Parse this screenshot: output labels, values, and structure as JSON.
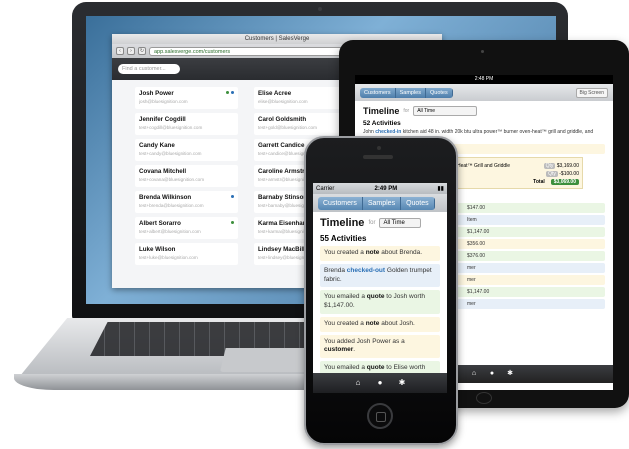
{
  "browser": {
    "window_title": "Customers | SalesVerge",
    "url": "app.salesverge.com/customers",
    "search_placeholder": "Find a customer..."
  },
  "customers": [
    {
      "name": "Josh Power",
      "email": "josh@bluesignition.com"
    },
    {
      "name": "Elise Acree",
      "email": "elise@bluesignition.com"
    },
    {
      "name": "Jennifer Cogdill",
      "email": "test+cogdill@bluesignition.com"
    },
    {
      "name": "Carol Goldsmith",
      "email": "test+gold@bluesignition.com"
    },
    {
      "name": "Candy Kane",
      "email": "test+candy@bluesignition.com"
    },
    {
      "name": "Garrett Candice",
      "email": "test+candice@bluesignition.com"
    },
    {
      "name": "Covana Mitchell",
      "email": "test+covana@bluesignition.com"
    },
    {
      "name": "Caroline Armstr",
      "email": "test+armstr@bluesignition.com"
    },
    {
      "name": "Brenda Wilkinson",
      "email": "test+brenda@bluesignition.com"
    },
    {
      "name": "Barnaby Stinson",
      "email": "test+barnaby@bluesignition.com"
    },
    {
      "name": "Albert Sorarro",
      "email": "test+albert@bluesignition.com"
    },
    {
      "name": "Karma Eisenhar",
      "email": "test+karma@bluesignition.com"
    },
    {
      "name": "Luke Wilson",
      "email": "test+luke@bluesignition.com"
    },
    {
      "name": "Lindsey MacBill",
      "email": "test+lindsey@bluesignition.com"
    }
  ],
  "ipad": {
    "status_time": "2:48 PM",
    "tabs": [
      "Customers",
      "Samples",
      "Quotes"
    ],
    "big_screen": "Big Screen",
    "timeline_title": "Timeline",
    "for_label": "for",
    "filter_value": "All Time",
    "activity_count": "52 Activities",
    "first_activity_pre": "John",
    "first_activity_action": "checked-in",
    "first_activity_post": "kitchen aid 48 in. width 20k btu ultra power™ burner oven-heat™ grill and griddle, and Orange tango shade fabric",
    "amount_row": "$3,093.00",
    "order_item": "Burner Oven-Heat™ Grill and Griddle",
    "order_qty": "Qty",
    "order_price_1": "$3,169.00",
    "order_price_2": "-$100.00",
    "total_label": "Total",
    "total_value": "$3,069.00",
    "side_amounts": [
      "$147.00",
      "$1,147.00",
      "$356.00",
      "$376.00",
      "$1,147.00"
    ],
    "side_words": [
      "Item",
      "mer",
      "mer",
      "mer"
    ]
  },
  "iphone": {
    "carrier": "Carrier",
    "time": "2:49 PM",
    "tabs": [
      "Customers",
      "Samples",
      "Quotes"
    ],
    "timeline_title": "Timeline",
    "for_label": "for",
    "filter_value": "All Time",
    "activity_count": "55 Activities",
    "items": {
      "a1_pre": "You created a",
      "a1_bold": "note",
      "a1_post": "about Brenda.",
      "a2_pre": "Brenda",
      "a2_action": "checked-out",
      "a2_post": "Golden trumpet fabric.",
      "a3_pre": "You emailed a",
      "a3_bold": "quote",
      "a3_post": "to Josh worth $1,147.00.",
      "a4_pre": "You created a",
      "a4_bold": "note",
      "a4_post": "about Josh.",
      "a5_pre": "You added Josh Power as a",
      "a5_bold": "customer",
      "a5_post": ".",
      "a6_pre": "You emailed a",
      "a6_bold": "quote",
      "a6_post": "to Elise worth"
    }
  },
  "icons": {
    "home": "home-icon",
    "user": "user-icon",
    "gear": "gear-icon"
  },
  "colors": {
    "accent": "#4e7eab",
    "checked": "#2a6fb5",
    "total_badge": "#3c8f3c"
  }
}
